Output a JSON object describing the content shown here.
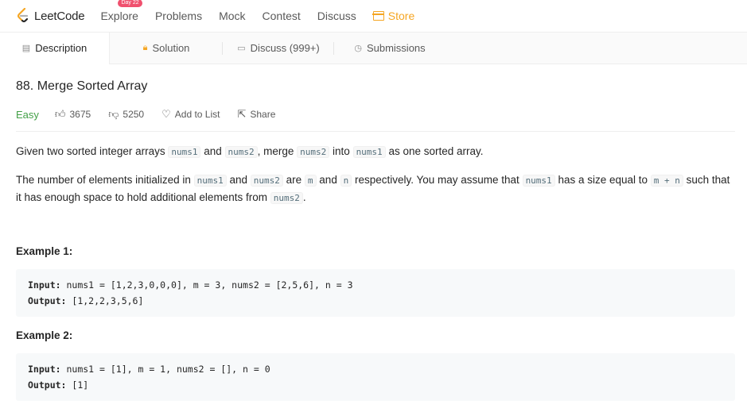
{
  "nav": {
    "logo_text": "LeetCode",
    "items": [
      "Explore",
      "Problems",
      "Mock",
      "Contest",
      "Discuss"
    ],
    "badge": "Day 22",
    "store": "Store"
  },
  "tabs": {
    "description": "Description",
    "solution": "Solution",
    "discuss": "Discuss (999+)",
    "submissions": "Submissions"
  },
  "problem": {
    "title": "88. Merge Sorted Array",
    "difficulty": "Easy",
    "likes": "3675",
    "dislikes": "5250",
    "add_to_list": "Add to List",
    "share": "Share"
  },
  "description": {
    "p1": [
      "Given two sorted integer arrays ",
      "nums1",
      " and ",
      "nums2",
      ", merge ",
      "nums2",
      " into ",
      "nums1",
      " as one sorted array."
    ],
    "p2": [
      "The number of elements initialized in ",
      "nums1",
      " and ",
      "nums2",
      " are ",
      "m",
      " and ",
      "n",
      " respectively. You may assume that ",
      "nums1",
      " has a size equal to ",
      "m + n",
      " such that it has enough space to hold additional elements from ",
      "nums2",
      "."
    ]
  },
  "examples": [
    {
      "title": "Example 1:",
      "input_label": "Input:",
      "input": " nums1 = [1,2,3,0,0,0], m = 3, nums2 = [2,5,6], n = 3",
      "output_label": "Output:",
      "output": " [1,2,2,3,5,6]"
    },
    {
      "title": "Example 2:",
      "input_label": "Input:",
      "input": " nums1 = [1], m = 1, nums2 = [], n = 0",
      "output_label": "Output:",
      "output": " [1]"
    }
  ],
  "colors": {
    "accent": "#f5a623",
    "easy": "#43a047",
    "badge": "#f0506e"
  }
}
